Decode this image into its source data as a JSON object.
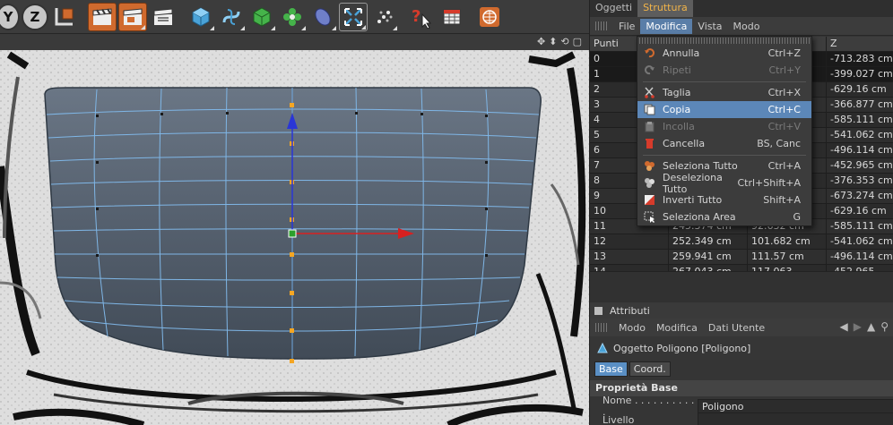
{
  "toolbar": {
    "axis_y": "Y",
    "axis_z": "Z",
    "colors": {
      "orange": "#d06a2e",
      "cube_blue": "#4aa3d8",
      "green": "#45b34a",
      "red": "#d63b2b"
    }
  },
  "right_panel": {
    "tabs": [
      {
        "label": "Oggetti"
      },
      {
        "label": "Struttura"
      }
    ],
    "menubar": [
      {
        "label": "File"
      },
      {
        "label": "Modifica"
      },
      {
        "label": "Vista"
      },
      {
        "label": "Modo"
      }
    ],
    "table": {
      "headers": [
        "Punti",
        "",
        "",
        "Z"
      ],
      "rows": [
        [
          "0",
          "",
          "",
          "-713.283 cm"
        ],
        [
          "1",
          "",
          "",
          "-399.027 cm"
        ],
        [
          "2",
          "",
          "",
          "-629.16 cm"
        ],
        [
          "3",
          "",
          "",
          "-366.877 cm"
        ],
        [
          "4",
          "",
          "",
          "-585.111 cm"
        ],
        [
          "5",
          "",
          "",
          "-541.062 cm"
        ],
        [
          "6",
          "",
          "",
          "-496.114 cm"
        ],
        [
          "7",
          "",
          "",
          "-452.965 cm"
        ],
        [
          "8",
          "",
          "",
          "-376.353 cm"
        ],
        [
          "9",
          "",
          "",
          "-673.274 cm"
        ],
        [
          "10",
          "",
          "",
          "-629.16 cm"
        ],
        [
          "11",
          "245.374 cm",
          "92.632 cm",
          "-585.111 cm"
        ],
        [
          "12",
          "252.349 cm",
          "101.682 cm",
          "-541.062 cm"
        ],
        [
          "13",
          "259.941 cm",
          "111.57 cm",
          "-496.114 cm"
        ],
        [
          "14",
          "267.043 cm",
          "117.063",
          "-452.965"
        ]
      ]
    },
    "attributes": {
      "title": "Attributi",
      "menu": [
        "Modo",
        "Modifica",
        "Dati Utente"
      ],
      "object_label": "Oggetto Poligono [Poligono]",
      "tabs": [
        "Base",
        "Coord."
      ],
      "section": "Proprietà Base",
      "name_label": "Nome . . . . . . . . . . .",
      "name_value": "Poligono",
      "level_label": "Livello"
    }
  },
  "dropdown": {
    "items": [
      {
        "label": "Annulla",
        "key": "Ctrl+Z",
        "icon": "undo-icon",
        "state": "normal"
      },
      {
        "label": "Ripeti",
        "key": "Ctrl+Y",
        "icon": "redo-icon",
        "state": "disabled"
      },
      {
        "sep": true
      },
      {
        "label": "Taglia",
        "key": "Ctrl+X",
        "icon": "scissors-icon",
        "state": "normal"
      },
      {
        "label": "Copia",
        "key": "Ctrl+C",
        "icon": "copy-icon",
        "state": "highlighted"
      },
      {
        "label": "Incolla",
        "key": "Ctrl+V",
        "icon": "paste-icon",
        "state": "disabled"
      },
      {
        "label": "Cancella",
        "key": "BS, Canc",
        "icon": "trash-icon",
        "state": "normal"
      },
      {
        "sep": true
      },
      {
        "label": "Seleziona Tutto",
        "key": "Ctrl+A",
        "icon": "select-all-icon",
        "state": "normal"
      },
      {
        "label": "Deseleziona Tutto",
        "key": "Ctrl+Shift+A",
        "icon": "deselect-all-icon",
        "state": "normal"
      },
      {
        "label": "Inverti Tutto",
        "key": "Shift+A",
        "icon": "invert-icon",
        "state": "normal"
      },
      {
        "label": "Seleziona Area",
        "key": "G",
        "icon": "select-area-icon",
        "state": "normal"
      }
    ]
  }
}
